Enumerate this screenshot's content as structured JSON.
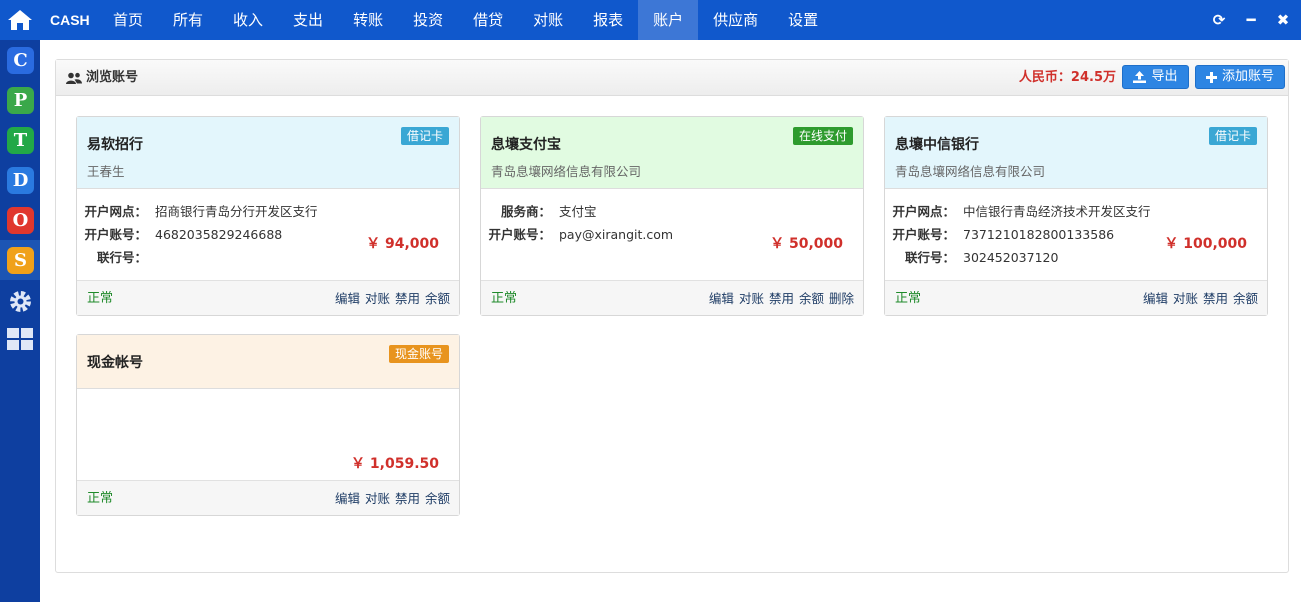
{
  "app": {
    "brand": "CASH"
  },
  "nav": [
    {
      "label": "首页"
    },
    {
      "label": "所有"
    },
    {
      "label": "收入"
    },
    {
      "label": "支出"
    },
    {
      "label": "转账"
    },
    {
      "label": "投资"
    },
    {
      "label": "借贷"
    },
    {
      "label": "对账"
    },
    {
      "label": "报表"
    },
    {
      "label": "账户",
      "active": true
    },
    {
      "label": "供应商"
    },
    {
      "label": "设置"
    }
  ],
  "window_controls": {
    "refresh": "⟳",
    "minimize": "━",
    "close": "✖"
  },
  "rail": [
    {
      "letter": "C",
      "color": "#2a6be0",
      "icon": "c-app-icon"
    },
    {
      "letter": "P",
      "color": "#3aa84a",
      "icon": "p-app-icon"
    },
    {
      "letter": "T",
      "color": "#22a847",
      "icon": "t-app-icon"
    },
    {
      "letter": "D",
      "color": "#2a7ae0",
      "icon": "d-app-icon"
    },
    {
      "letter": "O",
      "color": "#e0372e",
      "icon": "o-app-icon"
    },
    {
      "letter": "S",
      "color": "#f0a11a",
      "icon": "s-app-icon"
    }
  ],
  "panel": {
    "title": "浏览账号",
    "total": "人民币：24.5万",
    "export_label": "导出",
    "add_label": "添加账号"
  },
  "accounts": [
    {
      "name": "易软招行",
      "sub": "王春生",
      "badge": "借记卡",
      "badge_color": "#3aa7d4",
      "head_bg": "#e3f6fc",
      "fields": [
        {
          "k": "开户网点：",
          "v": "招商银行青岛分行开发区支行"
        },
        {
          "k": "开户账号：",
          "v": "4682035829246688"
        },
        {
          "k": "联行号：",
          "v": ""
        }
      ],
      "amount": "￥ 94,000",
      "status": "正常",
      "actions": [
        "编辑",
        "对账",
        "禁用",
        "余额"
      ]
    },
    {
      "name": "息壤支付宝",
      "sub": "青岛息壤网络信息有限公司",
      "badge": "在线支付",
      "badge_color": "#2e9b2e",
      "head_bg": "#e1fbe1",
      "fields": [
        {
          "k": "服务商：",
          "v": "支付宝"
        },
        {
          "k": "开户账号：",
          "v": "pay@xirangit.com"
        }
      ],
      "amount": "￥ 50,000",
      "status": "正常",
      "actions": [
        "编辑",
        "对账",
        "禁用",
        "余额",
        "删除"
      ]
    },
    {
      "name": "息壤中信银行",
      "sub": "青岛息壤网络信息有限公司",
      "badge": "借记卡",
      "badge_color": "#3aa7d4",
      "head_bg": "#e3f6fc",
      "fields": [
        {
          "k": "开户网点：",
          "v": "中信银行青岛经济技术开发区支行"
        },
        {
          "k": "开户账号：",
          "v": "7371210182800133586"
        },
        {
          "k": "联行号：",
          "v": "302452037120"
        }
      ],
      "amount": "￥ 100,000",
      "status": "正常",
      "actions": [
        "编辑",
        "对账",
        "禁用",
        "余额"
      ]
    },
    {
      "name": "现金帐号",
      "sub": "",
      "badge": "现金账号",
      "badge_color": "#e8941e",
      "head_bg": "#fdf2e4",
      "fields": [],
      "amount": "￥ 1,059.50",
      "status": "正常",
      "actions": [
        "编辑",
        "对账",
        "禁用",
        "余额"
      ]
    }
  ]
}
